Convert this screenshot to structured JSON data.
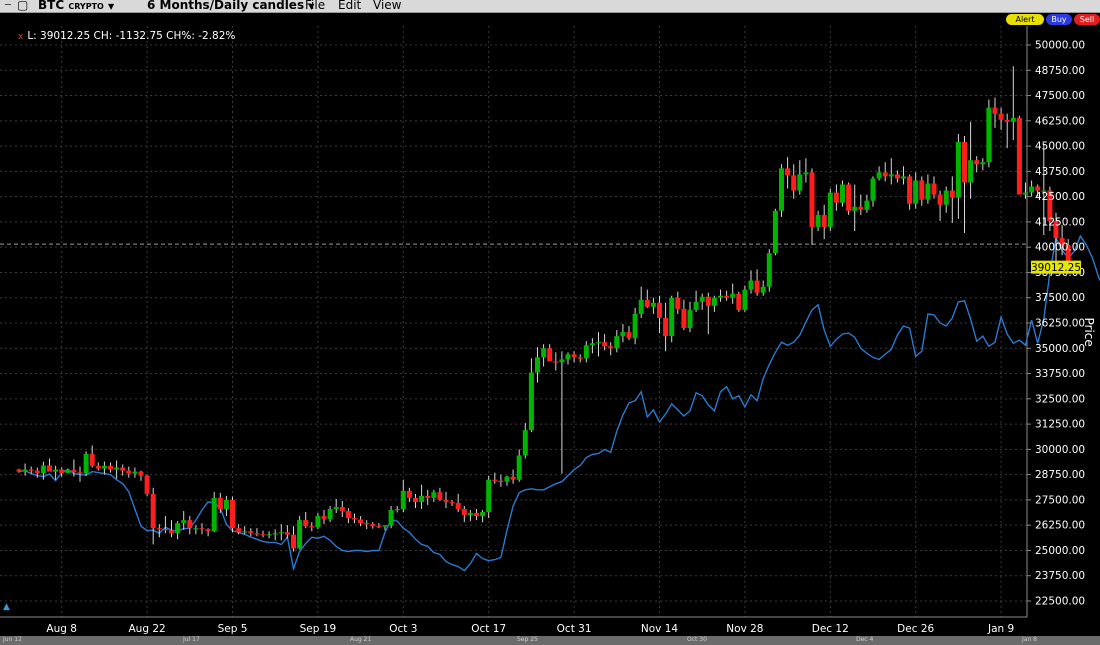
{
  "menubar": {
    "symbol": "BTC",
    "symbol_type": "CRYPTO",
    "dropdown_glyph": "▼",
    "period": "6 Months/Daily candles",
    "menu": [
      "File",
      "Edit",
      "View"
    ]
  },
  "order_buttons": {
    "alert": "Alert",
    "buy": "Buy",
    "sell": "Sell"
  },
  "info_bar": {
    "close_icon": "x",
    "text": "L: 39012.25 CH: -1132.75 CH%: -2.82%"
  },
  "colors": {
    "background": "#000000",
    "up": "#00b400",
    "down": "#ff1e1e",
    "line": "#2a7ad0",
    "price_tag": "#e6e600"
  },
  "chart_data": {
    "type": "candlestick",
    "ylabel": "Price",
    "ylim": [
      21250,
      51000
    ],
    "y_ticks": [
      22500,
      23750,
      25000,
      26250,
      27500,
      28750,
      30000,
      31250,
      32500,
      33750,
      35000,
      36250,
      37500,
      38750,
      40000,
      41250,
      42500,
      43750,
      45000,
      46250,
      47500,
      48750,
      50000
    ],
    "y_tick_labels": [
      "22500.00",
      "23750.00",
      "25000.00",
      "26250.00",
      "27500.00",
      "28750.00",
      "30000.00",
      "31250.00",
      "32500.00",
      "33750.00",
      "35000.00",
      "36250.00",
      "37500.00",
      "38750.00",
      "40000.00",
      "41250.00",
      "42500.00",
      "43750.00",
      "45000.00",
      "46250.00",
      "47500.00",
      "48750.00",
      "50000.00"
    ],
    "x_labels": [
      "Aug 8",
      "Aug 22",
      "Sep 5",
      "Sep 19",
      "Oct 3",
      "Oct 17",
      "Oct 31",
      "Nov 14",
      "Nov 28",
      "Dec 12",
      "Dec 26",
      "Jan 9"
    ],
    "x_label_index": [
      7,
      21,
      35,
      49,
      63,
      77,
      91,
      105,
      119,
      133,
      147,
      161
    ],
    "overview_labels": [
      "Jun 12",
      "Jul 17",
      "Aug 21",
      "Sep 25",
      "Oct 30",
      "Dec 4",
      "Jan 8"
    ],
    "last_price": 39012.25,
    "last_price_label": "39012.25",
    "reference_line": 40150,
    "candles": [
      [
        29010,
        29040,
        28845,
        28900
      ],
      [
        28900,
        29300,
        28700,
        29000
      ],
      [
        29000,
        29150,
        28800,
        28950
      ],
      [
        28950,
        29100,
        28600,
        28820
      ],
      [
        28820,
        29390,
        28500,
        29200
      ],
      [
        29200,
        29550,
        28915,
        28900
      ],
      [
        28900,
        29190,
        28500,
        29000
      ],
      [
        29000,
        29100,
        28650,
        28833
      ],
      [
        28833,
        29050,
        28900,
        28990
      ],
      [
        28990,
        29500,
        28650,
        28870
      ],
      [
        28870,
        29150,
        28400,
        28800
      ],
      [
        28800,
        29900,
        28690,
        29780
      ],
      [
        29780,
        30190,
        29100,
        29180
      ],
      [
        29180,
        29355,
        28950,
        29050
      ],
      [
        29050,
        29400,
        28750,
        29185
      ],
      [
        29185,
        29350,
        28850,
        29000
      ],
      [
        29000,
        29450,
        28550,
        29100
      ],
      [
        29100,
        29250,
        28700,
        28950
      ],
      [
        28950,
        29150,
        28600,
        28800
      ],
      [
        28800,
        29100,
        28600,
        28900
      ],
      [
        28900,
        28950,
        28450,
        28700
      ],
      [
        28700,
        28750,
        27700,
        27800
      ],
      [
        27800,
        28100,
        25300,
        26100
      ],
      [
        26100,
        26300,
        25650,
        26060
      ],
      [
        26060,
        26700,
        25850,
        26000
      ],
      [
        26000,
        26500,
        25660,
        25850
      ],
      [
        25850,
        26450,
        25550,
        26350
      ],
      [
        26350,
        26950,
        26020,
        26500
      ],
      [
        26500,
        26700,
        25800,
        26100
      ],
      [
        26100,
        26250,
        25800,
        26100
      ],
      [
        26100,
        26350,
        25800,
        26050
      ],
      [
        26050,
        26100,
        25700,
        25950
      ],
      [
        25950,
        27900,
        25900,
        27600
      ],
      [
        27600,
        27850,
        26850,
        27050
      ],
      [
        27050,
        27700,
        26700,
        27500
      ],
      [
        27500,
        27660,
        25900,
        26100
      ],
      [
        26100,
        26300,
        25800,
        25900
      ],
      [
        25900,
        26200,
        25800,
        25950
      ],
      [
        25950,
        26100,
        25700,
        25850
      ],
      [
        25850,
        26100,
        25700,
        25800
      ],
      [
        25800,
        25980,
        25650,
        25750
      ],
      [
        25750,
        25950,
        25600,
        25800
      ],
      [
        25800,
        26050,
        25500,
        25850
      ],
      [
        25850,
        26300,
        25500,
        25900
      ],
      [
        25900,
        26250,
        25600,
        25780
      ],
      [
        25780,
        26200,
        24950,
        25100
      ],
      [
        25100,
        26700,
        25050,
        26500
      ],
      [
        26500,
        26900,
        26100,
        26200
      ],
      [
        26200,
        26400,
        25950,
        26150
      ],
      [
        26150,
        26850,
        26050,
        26700
      ],
      [
        26700,
        27000,
        26300,
        26550
      ],
      [
        26550,
        27200,
        26400,
        27050
      ],
      [
        27050,
        27550,
        26850,
        27150
      ],
      [
        27150,
        27450,
        26650,
        26950
      ],
      [
        26950,
        27100,
        26350,
        26600
      ],
      [
        26600,
        26820,
        26350,
        26530
      ],
      [
        26530,
        26700,
        26200,
        26350
      ],
      [
        26350,
        26500,
        26050,
        26300
      ],
      [
        26300,
        26400,
        26080,
        26200
      ],
      [
        26200,
        26350,
        26100,
        26180
      ],
      [
        26180,
        26230,
        26000,
        26250
      ],
      [
        26250,
        27200,
        26100,
        27000
      ],
      [
        27000,
        27200,
        26880,
        27050
      ],
      [
        27050,
        28500,
        26900,
        27950
      ],
      [
        27950,
        28100,
        27400,
        27600
      ],
      [
        27600,
        27800,
        27100,
        27400
      ],
      [
        27400,
        28250,
        27050,
        27700
      ],
      [
        27700,
        28000,
        27250,
        27600
      ],
      [
        27600,
        28000,
        27400,
        27880
      ],
      [
        27880,
        28100,
        27450,
        27500
      ],
      [
        27500,
        27900,
        27100,
        27400
      ],
      [
        27400,
        27500,
        27200,
        27350
      ],
      [
        27350,
        27800,
        26900,
        27050
      ],
      [
        27050,
        27200,
        26400,
        26750
      ],
      [
        26750,
        27000,
        26450,
        26860
      ],
      [
        26860,
        27050,
        26500,
        26700
      ],
      [
        26700,
        27000,
        26400,
        26900
      ],
      [
        26900,
        28700,
        26600,
        28500
      ],
      [
        28500,
        28850,
        28300,
        28450
      ],
      [
        28450,
        28750,
        28150,
        28400
      ],
      [
        28400,
        28700,
        28200,
        28650
      ],
      [
        28650,
        29000,
        28300,
        28500
      ],
      [
        28500,
        30000,
        28400,
        29700
      ],
      [
        29700,
        31300,
        29550,
        30950
      ],
      [
        30950,
        34500,
        30850,
        33800
      ],
      [
        33800,
        35050,
        33300,
        34550
      ],
      [
        34550,
        35200,
        34100,
        35000
      ],
      [
        35000,
        35200,
        34350,
        34350
      ],
      [
        34350,
        34800,
        33900,
        34300
      ],
      [
        34300,
        34850,
        28800,
        34450
      ],
      [
        34450,
        34800,
        34200,
        34700
      ],
      [
        34700,
        34850,
        34300,
        34550
      ],
      [
        34550,
        34700,
        34300,
        34500
      ],
      [
        34500,
        35350,
        34300,
        35150
      ],
      [
        35150,
        35500,
        34750,
        35250
      ],
      [
        35250,
        35800,
        34600,
        35300
      ],
      [
        35300,
        35700,
        34900,
        35100
      ],
      [
        35100,
        35300,
        34650,
        35000
      ],
      [
        35000,
        35900,
        34800,
        35600
      ],
      [
        35600,
        36200,
        35300,
        35800
      ],
      [
        35800,
        36100,
        35400,
        35500
      ],
      [
        35500,
        37000,
        35200,
        36700
      ],
      [
        36700,
        38050,
        36500,
        37400
      ],
      [
        37400,
        37900,
        37000,
        37050
      ],
      [
        37050,
        37500,
        36700,
        37250
      ],
      [
        37250,
        37600,
        35750,
        36500
      ],
      [
        36500,
        37250,
        34850,
        35600
      ],
      [
        35600,
        37600,
        35300,
        37500
      ],
      [
        37500,
        37800,
        36700,
        36950
      ],
      [
        36950,
        37400,
        35900,
        36000
      ],
      [
        36000,
        37300,
        35800,
        36900
      ],
      [
        36900,
        37850,
        36800,
        37300
      ],
      [
        37300,
        37700,
        36900,
        37550
      ],
      [
        37550,
        37750,
        35700,
        37100
      ],
      [
        37100,
        37600,
        36800,
        37500
      ],
      [
        37500,
        37900,
        37300,
        37600
      ],
      [
        37600,
        37850,
        37350,
        37500
      ],
      [
        37500,
        38200,
        37200,
        37700
      ],
      [
        37700,
        37800,
        36800,
        36900
      ],
      [
        36900,
        38100,
        36800,
        37900
      ],
      [
        37900,
        38850,
        37700,
        38350
      ],
      [
        38350,
        38900,
        37600,
        37750
      ],
      [
        37750,
        38350,
        37600,
        38050
      ],
      [
        38050,
        39900,
        37800,
        39700
      ],
      [
        39700,
        41900,
        39600,
        41800
      ],
      [
        41800,
        44100,
        41500,
        43900
      ],
      [
        43900,
        44450,
        42900,
        43550
      ],
      [
        43550,
        44100,
        42400,
        42800
      ],
      [
        42800,
        44300,
        42600,
        43600
      ],
      [
        43600,
        44400,
        43200,
        43700
      ],
      [
        43700,
        43900,
        40100,
        41000
      ],
      [
        41000,
        41800,
        40800,
        41600
      ],
      [
        41600,
        42100,
        40400,
        41000
      ],
      [
        41000,
        42900,
        40800,
        42700
      ],
      [
        42700,
        43100,
        41800,
        42200
      ],
      [
        42200,
        43300,
        42000,
        43100
      ],
      [
        43100,
        43200,
        41600,
        41800
      ],
      [
        41800,
        43100,
        40800,
        42000
      ],
      [
        42000,
        42600,
        41600,
        41850
      ],
      [
        41850,
        42600,
        41700,
        42300
      ],
      [
        42300,
        43500,
        42000,
        43400
      ],
      [
        43400,
        44000,
        43300,
        43700
      ],
      [
        43700,
        44200,
        43250,
        43500
      ],
      [
        43500,
        44400,
        43100,
        43600
      ],
      [
        43600,
        43800,
        43200,
        43400
      ],
      [
        43400,
        44000,
        43100,
        43500
      ],
      [
        43500,
        43600,
        41850,
        42150
      ],
      [
        42150,
        43700,
        41900,
        43300
      ],
      [
        43300,
        43500,
        42050,
        42350
      ],
      [
        42350,
        43600,
        42150,
        43150
      ],
      [
        43150,
        43500,
        42400,
        42600
      ],
      [
        42600,
        42800,
        41300,
        42100
      ],
      [
        42100,
        43000,
        41700,
        42800
      ],
      [
        42800,
        43500,
        41200,
        42450
      ],
      [
        42450,
        45600,
        41400,
        45200
      ],
      [
        45200,
        45500,
        40700,
        43200
      ],
      [
        43200,
        46200,
        42400,
        44300
      ],
      [
        44300,
        44500,
        43700,
        44100
      ],
      [
        44100,
        44400,
        43800,
        44200
      ],
      [
        44200,
        47300,
        43950,
        46900
      ],
      [
        46900,
        47400,
        45900,
        46600
      ],
      [
        46600,
        46900,
        45800,
        46300
      ],
      [
        46300,
        46600,
        44900,
        46200
      ],
      [
        46200,
        48950,
        45300,
        46400
      ],
      [
        46400,
        46500,
        44350,
        42600
      ],
      [
        42600,
        43200,
        42400,
        42700
      ],
      [
        42700,
        43300,
        42500,
        43000
      ],
      [
        43000,
        43100,
        42500,
        42800
      ],
      [
        42800,
        45100,
        40600,
        42800
      ],
      [
        42800,
        43000,
        40800,
        41300
      ],
      [
        41300,
        41700,
        39000,
        40450
      ],
      [
        40450,
        41100,
        39600,
        40100
      ],
      [
        40100,
        40400,
        39000,
        39012.25
      ]
    ],
    "overlay_line": {
      "start_index": 0,
      "values": [
        28900,
        28950,
        28800,
        28700,
        28650,
        28780,
        28450,
        28850,
        29000,
        28800,
        28750,
        28720,
        28900,
        28850,
        28800,
        28750,
        28500,
        28300,
        27900,
        27050,
        26200,
        25980,
        26000,
        25850,
        26150,
        26000,
        25950,
        26080,
        26100,
        26500,
        27000,
        27400,
        27350,
        27100,
        26300,
        25970,
        25900,
        25800,
        25660,
        25550,
        25450,
        25400,
        25400,
        25300,
        25650,
        24100,
        24950,
        25350,
        25650,
        25600,
        25700,
        25500,
        25200,
        25000,
        24950,
        25000,
        25000,
        24950,
        25000,
        25000,
        25900,
        26500,
        26450,
        26100,
        25900,
        25550,
        25300,
        25200,
        24900,
        24800,
        24450,
        24300,
        24200,
        24000,
        24350,
        24850,
        24600,
        24500,
        24550,
        24650,
        26000,
        27200,
        27850,
        28000,
        28050,
        28000,
        28000,
        28150,
        28300,
        28400,
        28700,
        29000,
        29200,
        29600,
        29750,
        29800,
        30000,
        29850,
        30900,
        31700,
        32300,
        32400,
        32850,
        31600,
        31950,
        31350,
        31750,
        32250,
        31950,
        31650,
        31900,
        32800,
        32650,
        32200,
        31900,
        32850,
        33100,
        32500,
        32650,
        32100,
        32700,
        32400,
        33500,
        34200,
        34800,
        35300,
        35150,
        35300,
        35650,
        36300,
        36900,
        37150,
        35900,
        35100,
        35450,
        35700,
        35750,
        35550,
        35000,
        34750,
        34550,
        34450,
        34700,
        34950,
        35650,
        36100,
        36000,
        34600,
        34850,
        36700,
        36650,
        36250,
        36100,
        36500,
        37300,
        37350,
        36450,
        35350,
        35600,
        35100,
        35300,
        36550,
        35700,
        35250,
        35400,
        35150,
        36400,
        35250,
        36450,
        38750,
        40450,
        39850,
        39450,
        39800,
        40550,
        40100,
        39450,
        38500,
        37900,
        38650,
        37800,
        34800
      ]
    }
  }
}
